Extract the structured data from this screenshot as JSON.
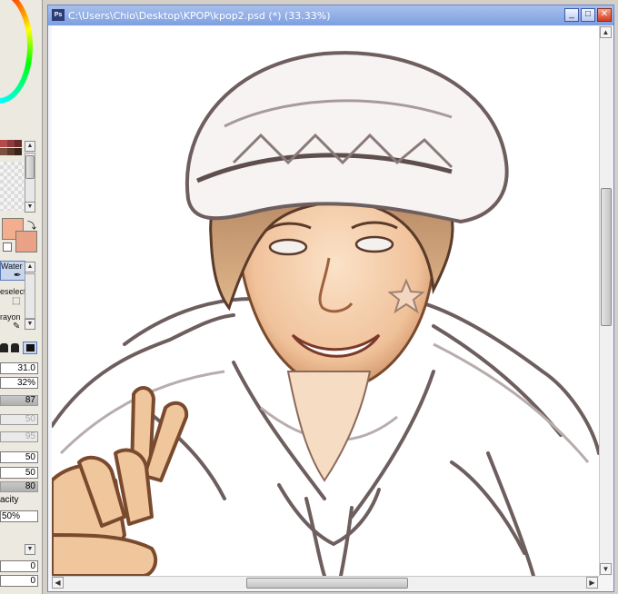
{
  "window": {
    "title": "C:\\Users\\Chio\\Desktop\\KPOP\\kpop2.psd (*) (33.33%)",
    "app_icon": "Ps",
    "buttons": {
      "minimize": "_",
      "restore": "□",
      "close": "✕"
    }
  },
  "canvas": {
    "description_icon": "illustration-icon"
  },
  "left_panel": {
    "tools": {
      "water": "Water",
      "deselect": "eselect",
      "crayon": "rayon"
    },
    "values": {
      "size": "31.0",
      "min_size": "32%",
      "density": "87",
      "bar_50a": "50",
      "bar_95": "95",
      "field_50a": "50",
      "field_50b": "50",
      "field_80": "80",
      "opacity_label": "acity",
      "opacity_value": "50%",
      "field_0a": "0",
      "field_0b": "0"
    }
  },
  "colors": {
    "foreground": "#f2ae8e",
    "background": "#e9a286",
    "title_gradient": "#7d9fe0"
  }
}
